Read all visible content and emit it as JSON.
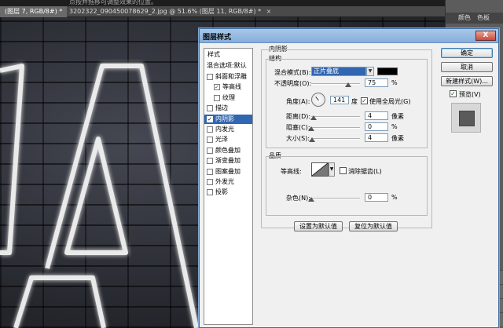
{
  "workspace": {
    "top_hint": "点按并拖移可调整效果的位置。",
    "tabs": [
      {
        "label": "(图层 7, RGB/8#) *",
        "active": true
      },
      {
        "label": "3202322_090450078629_2.jpg @ 51.6% (图层 11, RGB/8#) *",
        "active": false
      }
    ],
    "right_panel_tabs": [
      "颜色",
      "色板"
    ]
  },
  "dialog": {
    "title": "图层样式",
    "close_label": "X",
    "styles_header": "样式",
    "blend_options": "混合选项:默认",
    "styles": [
      {
        "label": "斜面和浮雕",
        "checked": false,
        "indent": false,
        "selected": false
      },
      {
        "label": "等高线",
        "checked": true,
        "indent": true,
        "selected": false
      },
      {
        "label": "纹理",
        "checked": false,
        "indent": true,
        "selected": false
      },
      {
        "label": "描边",
        "checked": false,
        "indent": false,
        "selected": false
      },
      {
        "label": "内阴影",
        "checked": true,
        "indent": false,
        "selected": true
      },
      {
        "label": "内发光",
        "checked": false,
        "indent": false,
        "selected": false
      },
      {
        "label": "光泽",
        "checked": false,
        "indent": false,
        "selected": false
      },
      {
        "label": "颜色叠加",
        "checked": false,
        "indent": false,
        "selected": false
      },
      {
        "label": "渐变叠加",
        "checked": false,
        "indent": false,
        "selected": false
      },
      {
        "label": "图案叠加",
        "checked": false,
        "indent": false,
        "selected": false
      },
      {
        "label": "外发光",
        "checked": false,
        "indent": false,
        "selected": false
      },
      {
        "label": "投影",
        "checked": false,
        "indent": false,
        "selected": false
      }
    ],
    "inner_shadow": {
      "section_title": "内阴影",
      "structure_title": "结构",
      "blend_mode_label": "混合模式(B):",
      "blend_mode_value": "正片叠底",
      "shadow_color": "#000000",
      "opacity_label": "不透明度(O):",
      "opacity_value": "75",
      "opacity_fraction": 0.75,
      "percent": "%",
      "angle_label": "角度(A):",
      "angle_value": "141",
      "degree": "度",
      "global_light_label": "使用全局光(G)",
      "global_light_checked": true,
      "distance_label": "距离(D):",
      "distance_value": "4",
      "choke_label": "阻塞(C):",
      "choke_value": "0",
      "size_label": "大小(S):",
      "size_value": "4",
      "px": "像素",
      "quality_title": "品质",
      "contour_label": "等高线:",
      "anti_alias_label": "消除锯齿(L)",
      "anti_alias_checked": false,
      "noise_label": "杂色(N):",
      "noise_value": "0",
      "set_default_button": "设置为默认值",
      "reset_default_button": "复位为默认值"
    },
    "buttons": {
      "ok": "确定",
      "cancel": "取消",
      "new_style": "新建样式(W)...",
      "preview_label": "预览(V)",
      "preview_checked": true
    }
  }
}
